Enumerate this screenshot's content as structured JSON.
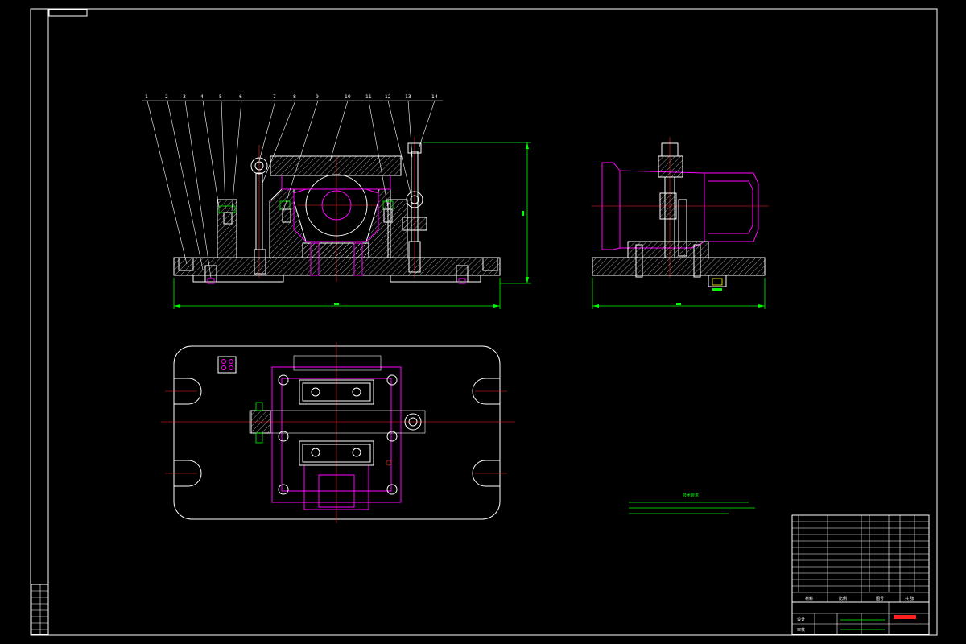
{
  "drawing": {
    "part_numbers": [
      "1",
      "2",
      "3",
      "4",
      "5",
      "6",
      "7",
      "8",
      "9",
      "10",
      "11",
      "12",
      "13",
      "14"
    ],
    "front_dimension_label": "",
    "side_dimension_label": "",
    "height_dimension_label": ""
  },
  "technical_requirements": {
    "title": "技术要求",
    "lines": [
      "",
      "",
      ""
    ]
  },
  "title_block": {
    "cell_material": "材料",
    "cell_scale": "比例",
    "cell_drawing_no": "图号",
    "cell_sheet": "共 张",
    "drawing_name": "",
    "cell_design": "设计",
    "cell_check": "审核"
  },
  "colors": {
    "outline": "#ffffff",
    "hidden_parts": "#ff00ff",
    "center_lines": "#ff2020",
    "dimensions": "#00ff00",
    "text_yellow": "#ffff00"
  }
}
